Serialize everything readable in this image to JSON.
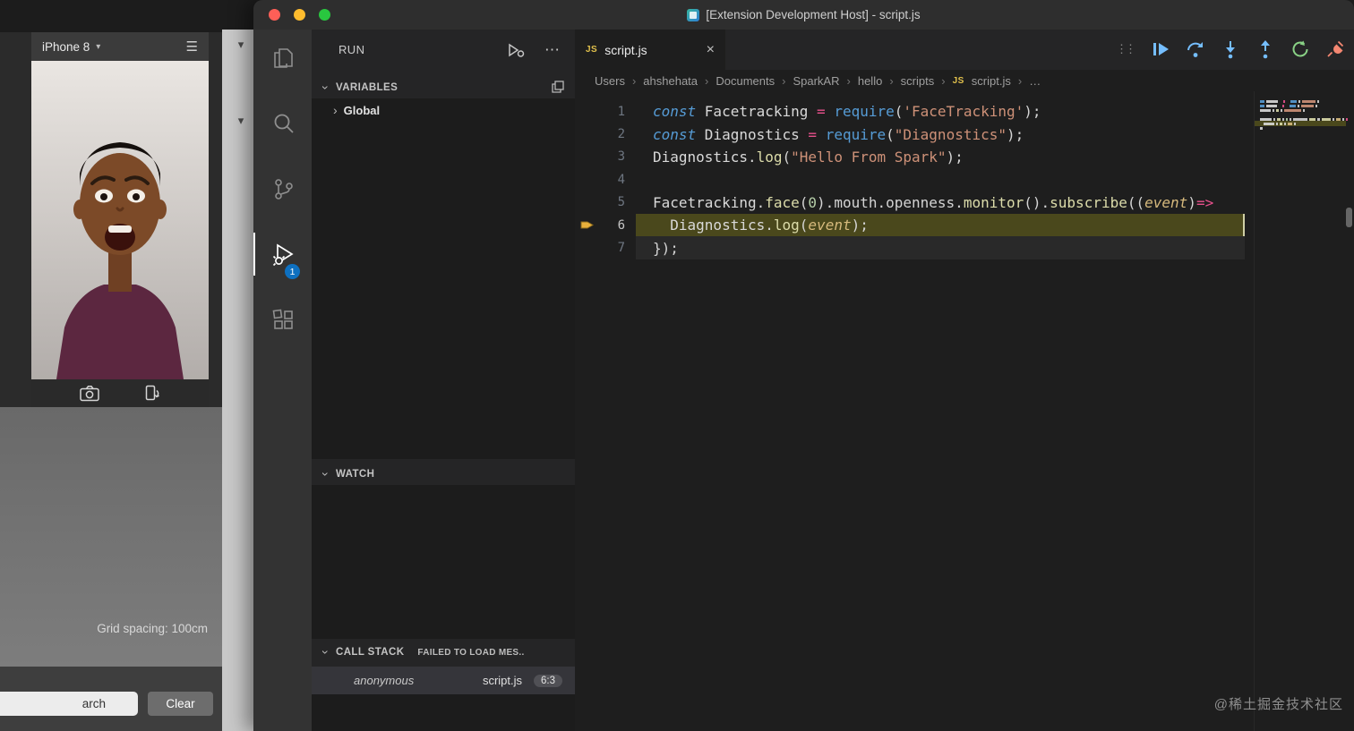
{
  "icons": {
    "dropdown": "▾",
    "hamburger": "☰",
    "chevron_right": "›",
    "ellipsis": "⋯",
    "close": "×",
    "js": "JS",
    "breadcrumb_sep": "›",
    "breadcrumb_tail": "…",
    "drag": "⋮⋮"
  },
  "colors": {
    "accent_blue": "#75beff",
    "restart_green": "#89d185",
    "disconnect_red": "#f48771",
    "debug_line_highlight": "#4a481c",
    "badge_blue": "#0e70c0"
  },
  "spark": {
    "device": "iPhone 8",
    "grid_label": "Grid spacing: 100cm",
    "search_value": "arch",
    "clear_label": "Clear"
  },
  "window": {
    "title": "[Extension Development Host] - script.js"
  },
  "activity": {
    "debug_badge": "1"
  },
  "debug_toolbar": [
    "drag-handle",
    "continue",
    "step-over",
    "step-into",
    "step-out",
    "restart",
    "disconnect"
  ],
  "sidebar": {
    "run_label": "RUN",
    "variables_label": "VARIABLES",
    "global_label": "Global",
    "watch_label": "WATCH",
    "call_stack_label": "CALL STACK",
    "call_stack_note": "FAILED TO LOAD MES..",
    "frames": [
      {
        "name": "anonymous",
        "file": "script.js",
        "loc": "6:3"
      }
    ]
  },
  "editor": {
    "tab_label": "script.js",
    "breadcrumb": [
      "Users",
      "ahshehata",
      "Documents",
      "SparkAR",
      "hello",
      "scripts"
    ],
    "breadcrumb_file": "script.js",
    "lines": [
      {
        "n": 1,
        "tokens": [
          [
            "kw",
            "const "
          ],
          [
            "id",
            "Facetracking"
          ],
          [
            "pl",
            " "
          ],
          [
            "op",
            "="
          ],
          [
            "pl",
            " "
          ],
          [
            "req",
            "require"
          ],
          [
            "pl",
            "("
          ],
          [
            "str",
            "'FaceTracking'"
          ],
          [
            "pl",
            ");"
          ]
        ]
      },
      {
        "n": 2,
        "tokens": [
          [
            "kw",
            "const "
          ],
          [
            "id",
            "Diagnostics"
          ],
          [
            "pl",
            " "
          ],
          [
            "op",
            "="
          ],
          [
            "pl",
            " "
          ],
          [
            "req",
            "require"
          ],
          [
            "pl",
            "("
          ],
          [
            "str",
            "\"Diagnostics\""
          ],
          [
            "pl",
            ");"
          ]
        ]
      },
      {
        "n": 3,
        "tokens": [
          [
            "id",
            "Diagnostics"
          ],
          [
            "pl",
            "."
          ],
          [
            "fn",
            "log"
          ],
          [
            "pl",
            "("
          ],
          [
            "str",
            "\"Hello From Spark\""
          ],
          [
            "pl",
            ");"
          ]
        ]
      },
      {
        "n": 4,
        "tokens": []
      },
      {
        "n": 5,
        "tokens": [
          [
            "id",
            "Facetracking"
          ],
          [
            "pl",
            "."
          ],
          [
            "fn",
            "face"
          ],
          [
            "pl",
            "("
          ],
          [
            "num",
            "0"
          ],
          [
            "pl",
            ")."
          ],
          [
            "pl",
            "mouth.openness."
          ],
          [
            "fn",
            "monitor"
          ],
          [
            "pl",
            "()."
          ],
          [
            "fn",
            "subscribe"
          ],
          [
            "pl",
            "(("
          ],
          [
            "par",
            "event"
          ],
          [
            "pl",
            ")"
          ],
          [
            "op",
            "=>"
          ]
        ]
      },
      {
        "n": 6,
        "current": true,
        "tokens": [
          [
            "pl",
            "  "
          ],
          [
            "id",
            "Diagnostics"
          ],
          [
            "pl",
            "."
          ],
          [
            "fn",
            "log"
          ],
          [
            "pl",
            "("
          ],
          [
            "par",
            "event"
          ],
          [
            "pl",
            ");"
          ]
        ]
      },
      {
        "n": 7,
        "tokens": [
          [
            "pl",
            "});"
          ]
        ]
      }
    ]
  },
  "watermark": "@稀土掘金技术社区"
}
